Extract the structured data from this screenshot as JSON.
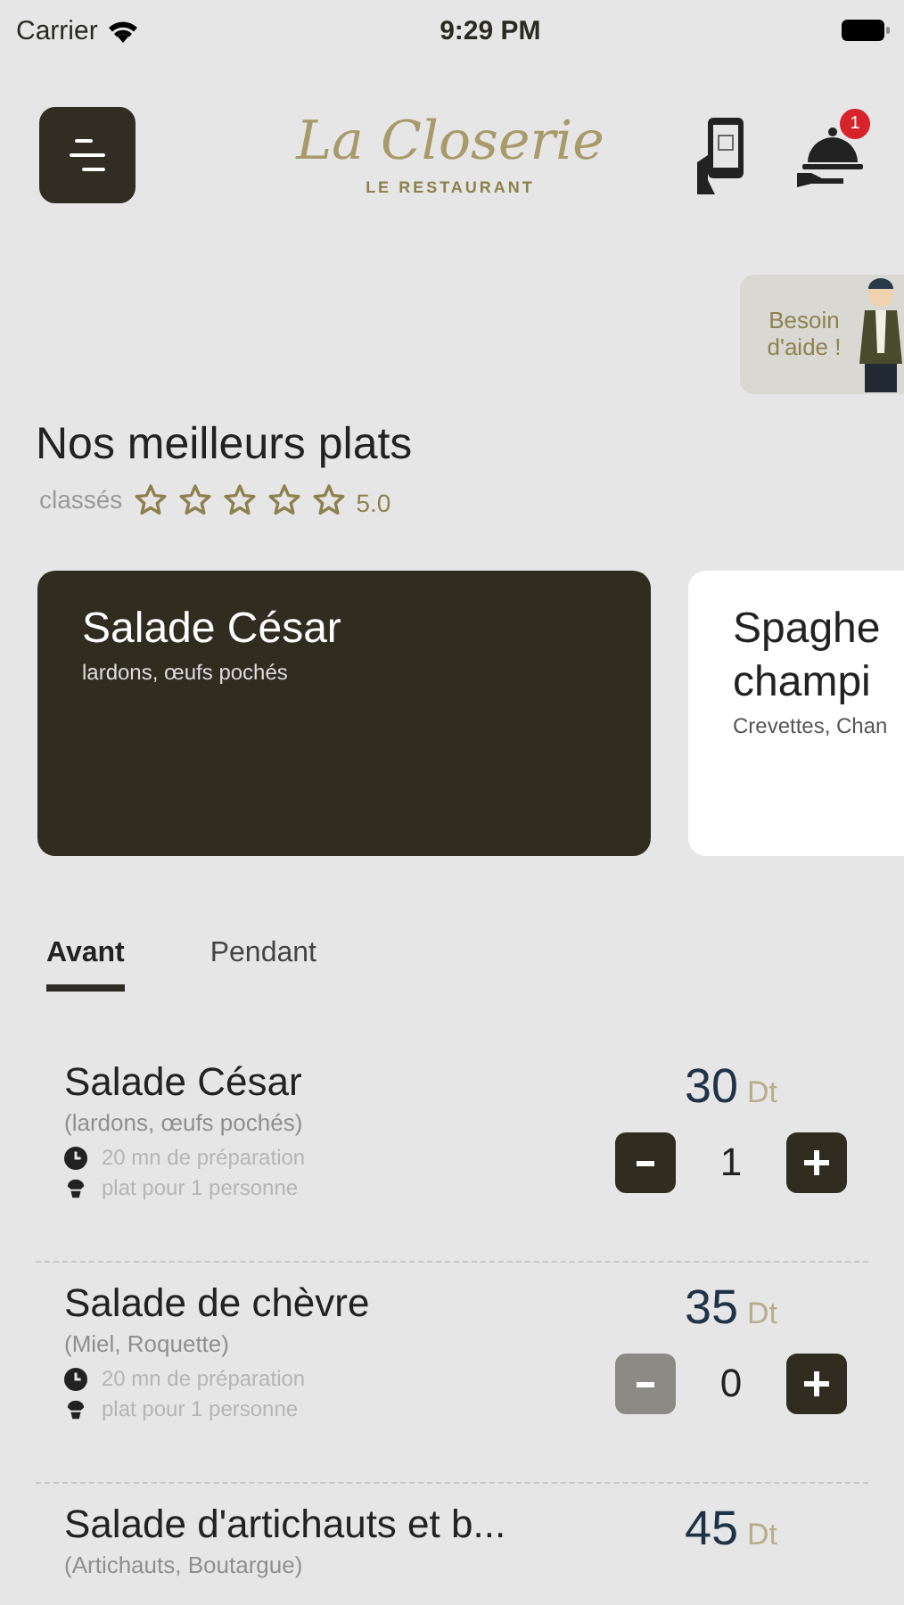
{
  "status_bar": {
    "carrier": "Carrier",
    "time": "9:29 PM"
  },
  "header": {
    "logo_script": "La Closerie",
    "logo_subtitle": "LE RESTAURANT",
    "notification_count": "1"
  },
  "help": {
    "label": "Besoin d'aide !"
  },
  "best": {
    "title": "Nos meilleurs plats",
    "label": "classés",
    "stars": 0,
    "rating": "5.0"
  },
  "featured": [
    {
      "name": "Salade César",
      "description": "lardons, œufs pochés",
      "selected": true
    },
    {
      "name": "Spaghe\nchampi",
      "description": "Crevettes, Chan",
      "selected": false
    }
  ],
  "tabs": [
    {
      "label": "Avant",
      "selected": true
    },
    {
      "label": "Pendant",
      "selected": false
    }
  ],
  "dishes": [
    {
      "name": "Salade César",
      "description": "(lardons, œufs pochés)",
      "prep": "20 mn de préparation",
      "serving": "plat pour 1 personne",
      "price": "30",
      "currency": "Dt",
      "quantity": "1",
      "minus_disabled": false
    },
    {
      "name": "Salade de chèvre",
      "description": "(Miel, Roquette)",
      "prep": "20 mn de préparation",
      "serving": "plat pour 1 personne",
      "price": "35",
      "currency": "Dt",
      "quantity": "0",
      "minus_disabled": true
    },
    {
      "name": "Salade d'artichauts et b...",
      "description": "(Artichauts, Boutargue)",
      "price": "45",
      "currency": "Dt"
    }
  ]
}
